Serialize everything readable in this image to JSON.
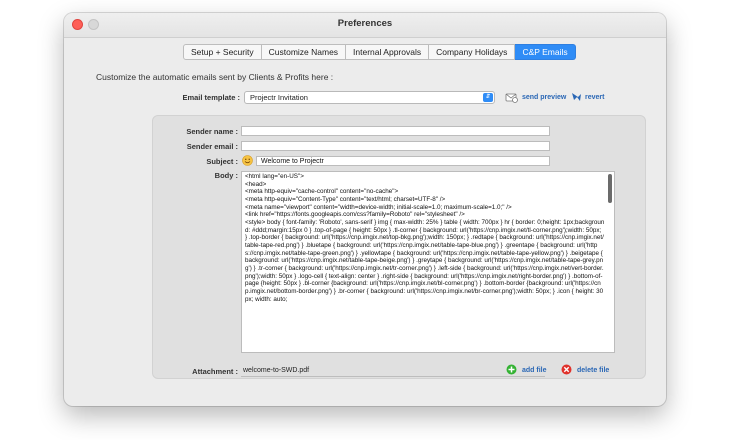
{
  "window": {
    "title": "Preferences"
  },
  "tabs": [
    {
      "label": "Setup + Security",
      "active": false
    },
    {
      "label": "Customize Names",
      "active": false
    },
    {
      "label": "Internal Approvals",
      "active": false
    },
    {
      "label": "Company Holidays",
      "active": false
    },
    {
      "label": "C&P Emails",
      "active": true
    }
  ],
  "intro": "Customize the automatic emails sent by Clients & Profits here :",
  "template": {
    "label": "Email template :",
    "value": "Projectr Invitation",
    "send_preview": "send preview",
    "revert": "revert"
  },
  "sender_name": {
    "label": "Sender name :",
    "value": ""
  },
  "sender_email": {
    "label": "Sender email :",
    "value": ""
  },
  "subject": {
    "label": "Subject :",
    "value": "Welcome to Projectr"
  },
  "body": {
    "label": "Body :",
    "value": "<html lang=\"en-US\">\n<head>\n<meta http-equiv=\"cache-control\" content=\"no-cache\">\n<meta http-equiv=\"Content-Type\" content=\"text/html; charset=UTF-8\" />\n<meta name=\"viewport\" content=\"width=device-width; initial-scale=1.0; maximum-scale=1.0;\" />\n<link href=\"https://fonts.googleapis.com/css?family=Roboto\" rel=\"stylesheet\" />\n<style> body { font-family: 'Roboto', sans-serif } img { max-width: 25% } table { width: 700px } hr { border: 0;height: 1px;background: #ddd;margin:15px 0 } .top-of-page { height: 50px } .tl-corner { background: url('https://cnp.imgix.net/tl-corner.png');width: 50px; } .top-border { background: url('https://cnp.imgix.net/top-bkg.png');width: 150px; } .redtape { background: url('https://cnp.imgix.net/table-tape-red.png') } .bluetape { background: url('https://cnp.imgix.net/table-tape-blue.png') } .greentape { background: url('https://cnp.imgix.net/table-tape-green.png') } .yellowtape { background: url('https://cnp.imgix.net/table-tape-yellow.png') } .beigetape { background: url('https://cnp.imgix.net/table-tape-beige.png') } .greytape { background: url('https://cnp.imgix.net/table-tape-grey.png') } .tr-corner { background: url('https://cnp.imgix.net/tr-corner.png') } .left-side { background: url('https://cnp.imgix.net/vert-border.png');width: 50px } .logo-cell { text-align: center } .right-side { background: url('https://cnp.imgix.net/right-border.png') } .bottom-of-page {height: 50px } .bl-corner {background: url('https://cnp.imgix.net/bl-corner.png') } .bottom-border {background: url('https://cnp.imgix.net/bottom-border.png') } .br-corner { background: url('https://cnp.imgix.net/br-corner.png');width: 50px; } .icon { height: 30px; width: auto;"
  },
  "attachment": {
    "label": "Attachment :",
    "value": "welcome-to-SWD.pdf",
    "add_file": "add file",
    "delete_file": "delete file"
  },
  "colors": {
    "accent": "#2f8cf6",
    "link": "#2a67b5",
    "add_green": "#34b233",
    "delete_red": "#e0322c"
  },
  "icons": [
    "send-preview-icon",
    "revert-icon",
    "emoji-icon",
    "add-file-icon",
    "delete-file-icon"
  ]
}
